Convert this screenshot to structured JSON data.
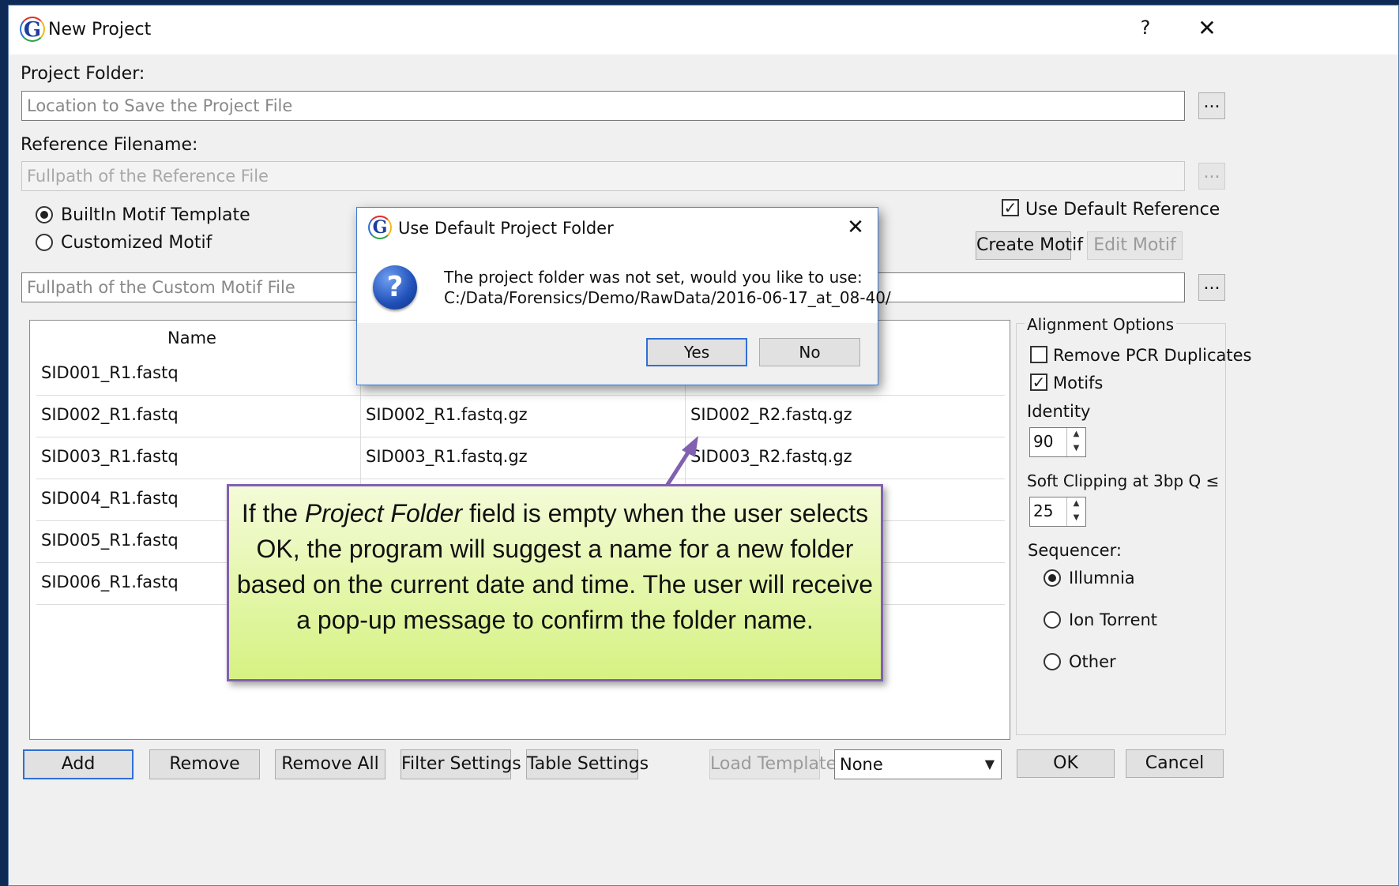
{
  "window": {
    "title": "New Project",
    "help_label": "?",
    "close_label": "✕"
  },
  "project_folder": {
    "label": "Project Folder:",
    "placeholder": "Location to Save the Project File",
    "browse_label": "..."
  },
  "reference": {
    "label": "Reference Filename:",
    "placeholder": "Fullpath of the Reference File",
    "browse_label": "...",
    "use_default_label": "Use Default Reference",
    "use_default_checked": true
  },
  "motif": {
    "builtin_label": "BuiltIn Motif Template",
    "custom_label": "Customized Motif",
    "selected": "builtin",
    "create_label": "Create Motif",
    "edit_label": "Edit Motif",
    "file_placeholder": "Fullpath of the Custom Motif File",
    "browse_label": "..."
  },
  "table": {
    "headers": [
      "Name"
    ],
    "rows": [
      {
        "name": "SID001_R1.fastq",
        "r1": "",
        "r2": ""
      },
      {
        "name": "SID002_R1.fastq",
        "r1": "SID002_R1.fastq.gz",
        "r2": "SID002_R2.fastq.gz"
      },
      {
        "name": "SID003_R1.fastq",
        "r1": "SID003_R1.fastq.gz",
        "r2": "SID003_R2.fastq.gz"
      },
      {
        "name": "SID004_R1.fastq",
        "r1": "",
        "r2": ""
      },
      {
        "name": "SID005_R1.fastq",
        "r1": "",
        "r2": ""
      },
      {
        "name": "SID006_R1.fastq",
        "r1": "",
        "r2": ""
      }
    ]
  },
  "alignment": {
    "title": "Alignment Options",
    "remove_pcr_label": "Remove PCR Duplicates",
    "remove_pcr_checked": false,
    "motifs_label": "Motifs",
    "motifs_checked": true,
    "identity_label": "Identity",
    "identity_value": "90",
    "soft_clip_label": "Soft Clipping at 3bp Q ≤",
    "soft_clip_value": "25",
    "sequencer_label": "Sequencer:",
    "sequencers": [
      "Illumnia",
      "Ion Torrent",
      "Other"
    ],
    "sequencer_selected": "Illumnia"
  },
  "bottom": {
    "add": "Add",
    "remove": "Remove",
    "remove_all": "Remove All",
    "filter_settings": "Filter Settings",
    "table_settings": "Table Settings",
    "load_template": "Load Template",
    "template_select": "None",
    "ok": "OK",
    "cancel": "Cancel"
  },
  "dialog": {
    "title": "Use Default Project Folder",
    "line1": "The project folder was not set, would you like to use:",
    "line2": "C:/Data/Forensics/Demo/RawData/2016-06-17_at_08-40/",
    "yes": "Yes",
    "no": "No",
    "close": "✕"
  },
  "callout": {
    "pre": "If the ",
    "emph": "Project Folder",
    "post": " field is empty when the user selects OK, the program will suggest a name for a new folder based on the current date and time. The user will receive a pop-up message to confirm the folder name."
  },
  "colors": {
    "background": "#0d2a57",
    "callout_border": "#8160b0",
    "callout_fill": "#d6f282",
    "focus_blue": "#2f6fd6"
  }
}
